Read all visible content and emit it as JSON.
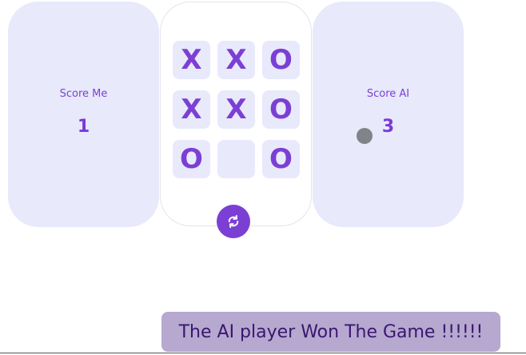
{
  "score_me": {
    "label": "Score Me",
    "value": "1"
  },
  "score_ai": {
    "label": "Score AI",
    "value": "3"
  },
  "board": {
    "cells": [
      "X",
      "X",
      "O",
      "X",
      "X",
      "O",
      "O",
      "",
      "O"
    ]
  },
  "reset": {
    "icon": "refresh-icon"
  },
  "message": "The AI player Won The Game !!!!!!",
  "colors": {
    "accent": "#7c3fd4",
    "card": "#e8e9fb",
    "banner": "#b6a8cf"
  }
}
